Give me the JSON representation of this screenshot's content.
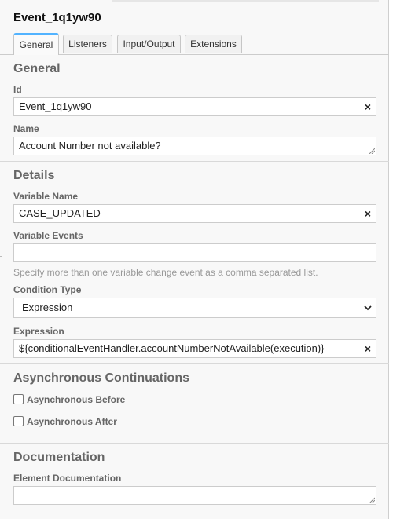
{
  "element_id_title": "Event_1q1yw90",
  "tabs": [
    {
      "label": "General"
    },
    {
      "label": "Listeners"
    },
    {
      "label": "Input/Output"
    },
    {
      "label": "Extensions"
    }
  ],
  "general": {
    "section_title": "General",
    "id_label": "Id",
    "id_value": "Event_1q1yw90",
    "name_label": "Name",
    "name_value": "Account Number not available?"
  },
  "details": {
    "section_title": "Details",
    "variable_name_label": "Variable Name",
    "variable_name_value": "CASE_UPDATED",
    "variable_events_label": "Variable Events",
    "variable_events_value": "",
    "variable_events_hint": "Specify more than one variable change event as a comma separated list.",
    "condition_type_label": "Condition Type",
    "condition_type_value": "Expression",
    "expression_label": "Expression",
    "expression_value": "${conditionalEventHandler.accountNumberNotAvailable(execution)}"
  },
  "async": {
    "section_title": "Asynchronous Continuations",
    "before_label": "Asynchronous Before",
    "before_checked": false,
    "after_label": "Asynchronous After",
    "after_checked": false
  },
  "documentation": {
    "section_title": "Documentation",
    "element_doc_label": "Element Documentation",
    "element_doc_value": ""
  },
  "icons": {
    "clear": "close-icon",
    "select_arrow": "chevron-down-icon",
    "resize": "resize-grip-icon"
  },
  "colors": {
    "active_tab_accent": "#52b3ff",
    "panel_background": "#f8f8f8",
    "section_title": "#666666"
  }
}
